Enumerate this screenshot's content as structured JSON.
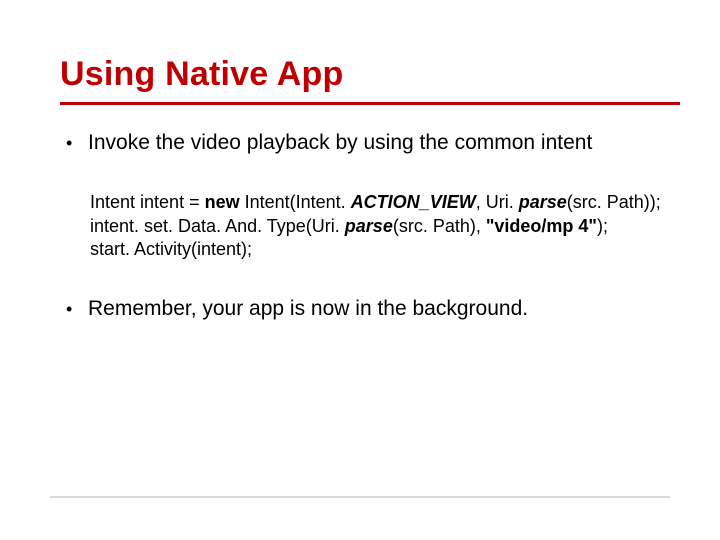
{
  "title": "Using Native App",
  "bullet1": "Invoke the video playback by using the common intent",
  "code": {
    "l1_a": "Intent intent = ",
    "l1_new": "new ",
    "l1_b": "Intent(Intent. ",
    "l1_action": "ACTION_VIEW",
    "l1_c": ", Uri. ",
    "l1_parse": "parse",
    "l1_d": "(src. Path));",
    "l2_a": "intent. set. Data. And. Type(Uri. ",
    "l2_parse": "parse",
    "l2_b": "(src. Path), ",
    "l2_str": "\"video/mp 4\"",
    "l2_c": ");",
    "l3": "start. Activity(intent);"
  },
  "bullet2": "Remember, your app is now in the background."
}
